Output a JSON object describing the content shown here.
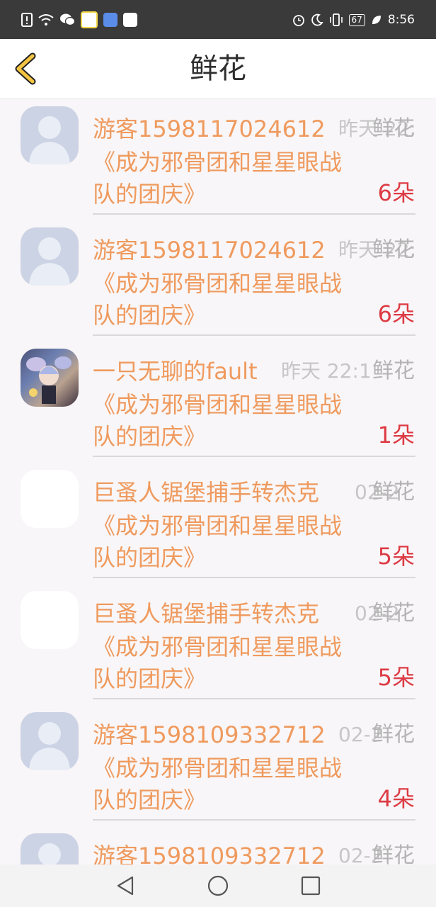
{
  "status_bar": {
    "time": "8:56",
    "battery": "67",
    "left_icons": [
      "sim-alert-icon",
      "wifi-icon",
      "wechat-icon",
      "app-icon",
      "music-icon",
      "radio-icon"
    ],
    "right_icons": [
      "alarm-icon",
      "moon-icon",
      "vibrate-icon",
      "battery-icon",
      "leaf-icon"
    ]
  },
  "header": {
    "title": "鲜花",
    "back_icon": "chevron-left-icon"
  },
  "list": {
    "items": [
      {
        "user": "游客1598117024612",
        "time": "昨天 22:47",
        "label": "鲜花",
        "message": "《成为邪骨团和星星眼战队的团庆》",
        "count": "6朵",
        "avatar": "placeholder"
      },
      {
        "user": "游客1598117024612",
        "time": "昨天 22:47",
        "label": "鲜花",
        "message": "《成为邪骨团和星星眼战队的团庆》",
        "count": "6朵",
        "avatar": "placeholder"
      },
      {
        "user": "一只无聊的fault",
        "time": "昨天 22:1",
        "label": "鲜花",
        "message": "《成为邪骨团和星星眼战队的团庆》",
        "count": "1朵",
        "avatar": "photo"
      },
      {
        "user": "巨蚤人锯堡捕手转杰克",
        "time": "02-2",
        "label": "鲜花",
        "message": "《成为邪骨团和星星眼战队的团庆》",
        "count": "5朵",
        "avatar": "blank"
      },
      {
        "user": "巨蚤人锯堡捕手转杰克",
        "time": "02-2",
        "label": "鲜花",
        "message": "《成为邪骨团和星星眼战队的团庆》",
        "count": "5朵",
        "avatar": "blank"
      },
      {
        "user": "游客1598109332712",
        "time": "02-2",
        "label": "鲜花",
        "message": "《成为邪骨团和星星眼战队的团庆》",
        "count": "4朵",
        "avatar": "placeholder"
      },
      {
        "user": "游客1598109332712",
        "time": "02-2",
        "label": "鲜花",
        "message": "",
        "count": "",
        "avatar": "placeholder"
      }
    ]
  },
  "nav_bar": {
    "icons": [
      "back-triangle-icon",
      "home-circle-icon",
      "recents-square-icon"
    ]
  },
  "colors": {
    "accent": "#ef9a5e",
    "count": "#dd3b44",
    "back": "#f5c542"
  }
}
